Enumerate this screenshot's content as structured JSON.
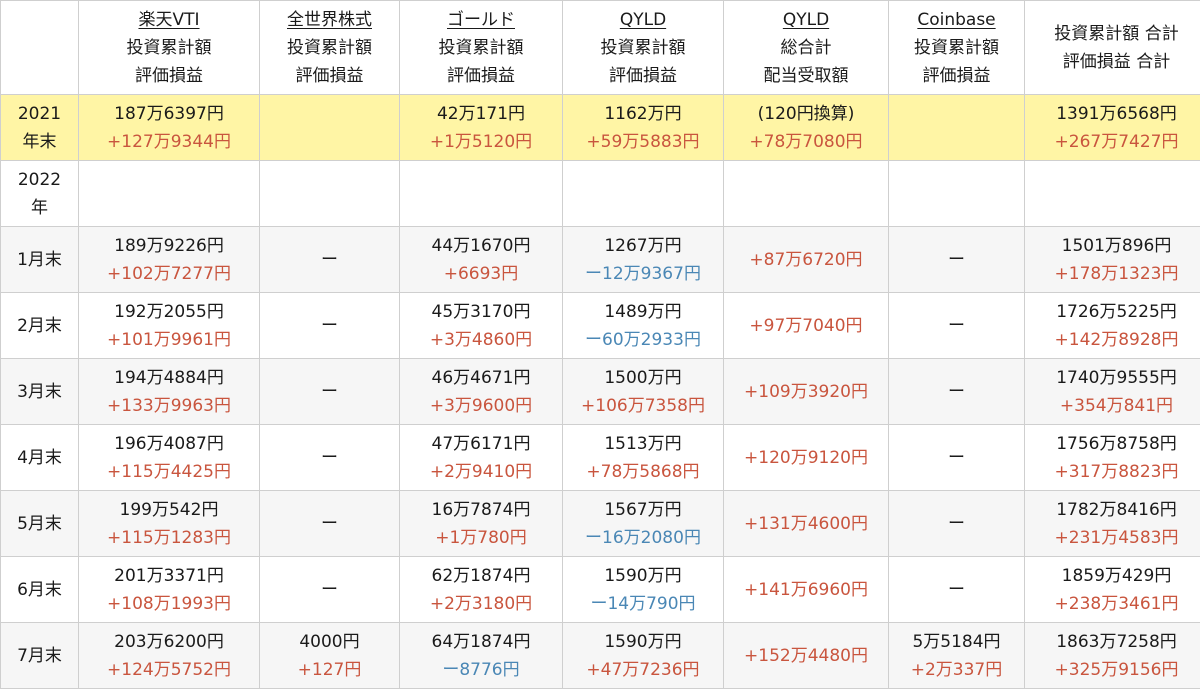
{
  "headers": [
    {
      "lines": [
        ""
      ]
    },
    {
      "title": "楽天VTI",
      "lines": [
        "投資累計額",
        "評価損益"
      ]
    },
    {
      "title": "全世界株式",
      "lines": [
        "投資累計額",
        "評価損益"
      ]
    },
    {
      "title": "ゴールド",
      "lines": [
        "投資累計額",
        "評価損益"
      ]
    },
    {
      "title": "QYLD",
      "lines": [
        "投資累計額",
        "評価損益"
      ]
    },
    {
      "title": "QYLD",
      "lines": [
        "総合計",
        "配当受取額"
      ]
    },
    {
      "title": "Coinbase",
      "lines": [
        "投資累計額",
        "評価損益"
      ]
    },
    {
      "title": "",
      "lines": [
        "投資累計額 合計",
        "評価損益 合計"
      ]
    }
  ],
  "rows": [
    {
      "label": [
        "2021",
        "年末"
      ],
      "cells": [
        [
          "187万6397円",
          "+127万9344円"
        ],
        [],
        [
          "42万171円",
          "+1万5120円"
        ],
        [
          "1162万円",
          "+59万5883円"
        ],
        [
          "(120円換算)",
          "+78万7080円"
        ],
        [],
        [
          "1391万6568円",
          "+267万7427円"
        ]
      ]
    },
    {
      "label": [
        "2022",
        "年"
      ],
      "cells": [
        [],
        [],
        [],
        [],
        [],
        [],
        []
      ]
    },
    {
      "label": [
        "1月末"
      ],
      "cells": [
        [
          "189万9226円",
          "+102万7277円"
        ],
        [
          "ー"
        ],
        [
          "44万1670円",
          "+6693円"
        ],
        [
          "1267万円",
          "ー12万9367円"
        ],
        [
          "+87万6720円"
        ],
        [
          "ー"
        ],
        [
          "1501万896円",
          "+178万1323円"
        ]
      ]
    },
    {
      "label": [
        "2月末"
      ],
      "cells": [
        [
          "192万2055円",
          "+101万9961円"
        ],
        [
          "ー"
        ],
        [
          "45万3170円",
          "+3万4860円"
        ],
        [
          "1489万円",
          "ー60万2933円"
        ],
        [
          "+97万7040円"
        ],
        [
          "ー"
        ],
        [
          "1726万5225円",
          "+142万8928円"
        ]
      ]
    },
    {
      "label": [
        "3月末"
      ],
      "cells": [
        [
          "194万4884円",
          "+133万9963円"
        ],
        [
          "ー"
        ],
        [
          "46万4671円",
          "+3万9600円"
        ],
        [
          "1500万円",
          "+106万7358円"
        ],
        [
          "+109万3920円"
        ],
        [
          "ー"
        ],
        [
          "1740万9555円",
          "+354万841円"
        ]
      ]
    },
    {
      "label": [
        "4月末"
      ],
      "cells": [
        [
          "196万4087円",
          "+115万4425円"
        ],
        [
          "ー"
        ],
        [
          "47万6171円",
          "+2万9410円"
        ],
        [
          "1513万円",
          "+78万5868円"
        ],
        [
          "+120万9120円"
        ],
        [
          "ー"
        ],
        [
          "1756万8758円",
          "+317万8823円"
        ]
      ]
    },
    {
      "label": [
        "5月末"
      ],
      "cells": [
        [
          "199万542円",
          "+115万1283円"
        ],
        [
          "ー"
        ],
        [
          "16万7874円",
          "+1万780円"
        ],
        [
          "1567万円",
          "ー16万2080円"
        ],
        [
          "+131万4600円"
        ],
        [
          "ー"
        ],
        [
          "1782万8416円",
          "+231万4583円"
        ]
      ]
    },
    {
      "label": [
        "6月末"
      ],
      "cells": [
        [
          "201万3371円",
          "+108万1993円"
        ],
        [
          "ー"
        ],
        [
          "62万1874円",
          "+2万3180円"
        ],
        [
          "1590万円",
          "ー14万790円"
        ],
        [
          "+141万6960円"
        ],
        [
          "ー"
        ],
        [
          "1859万429円",
          "+238万3461円"
        ]
      ]
    },
    {
      "label": [
        "7月末"
      ],
      "cells": [
        [
          "203万6200円",
          "+124万5752円"
        ],
        [
          "4000円",
          "+127円"
        ],
        [
          "64万1874円",
          "ー8776円"
        ],
        [
          "1590万円",
          "+47万7236円"
        ],
        [
          "+152万4480円"
        ],
        [
          "5万5184円",
          "+2万337円"
        ],
        [
          "1863万7258円",
          "+325万9156円"
        ]
      ]
    }
  ],
  "colors": {
    "highlight": "#fff5a5",
    "positive": "#c9553e",
    "negative": "#4a87b5",
    "stripe": "#f6f6f6",
    "border": "#cfcfcf"
  }
}
